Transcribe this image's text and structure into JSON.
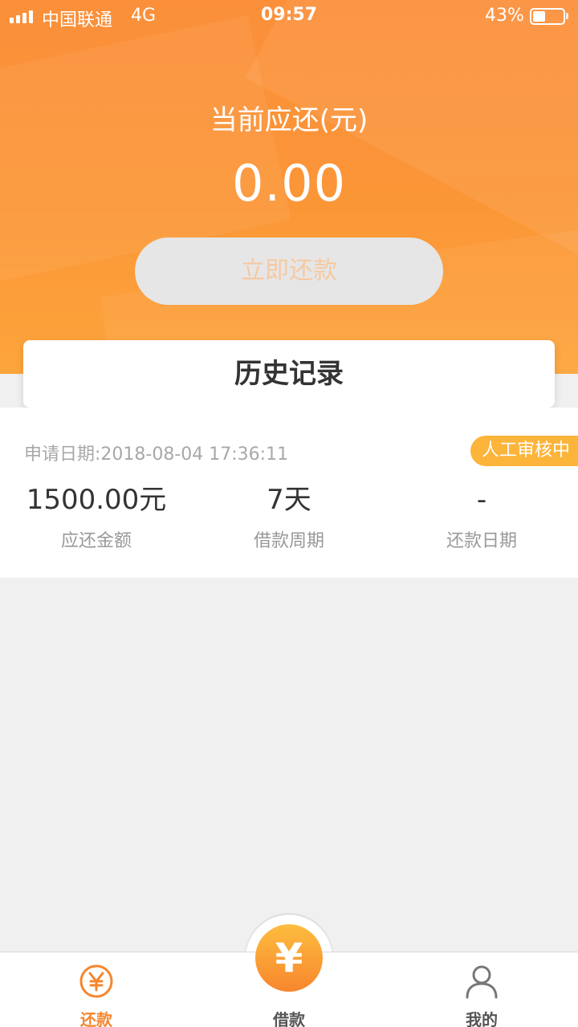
{
  "status_bar": {
    "carrier": "中国联通",
    "network": "4G",
    "time": "09:57",
    "battery_percent_text": "43%",
    "battery_level": 0.43
  },
  "header": {
    "due_label": "当前应还(元)",
    "due_amount": "0.00",
    "repay_button_label": "立即还款"
  },
  "history": {
    "title": "历史记录"
  },
  "record": {
    "apply_date": "申请日期:2018-08-04 17:36:11",
    "status": "人工审核中",
    "amount_value": "1500.00元",
    "amount_label": "应还金额",
    "period_value": "7天",
    "period_label": "借款周期",
    "repay_date_value": "-",
    "repay_date_label": "还款日期"
  },
  "tabs": {
    "repay": {
      "label": "还款",
      "icon": "yen-circle-icon",
      "active": true
    },
    "borrow": {
      "label": "借款",
      "icon": "yen-icon",
      "glyph": "¥"
    },
    "mine": {
      "label": "我的",
      "icon": "user-icon"
    }
  },
  "colors": {
    "accent": "#f5862e",
    "header_top": "#fb8f3a",
    "header_bottom": "#fda53c",
    "status_badge": "#fdb43a"
  }
}
